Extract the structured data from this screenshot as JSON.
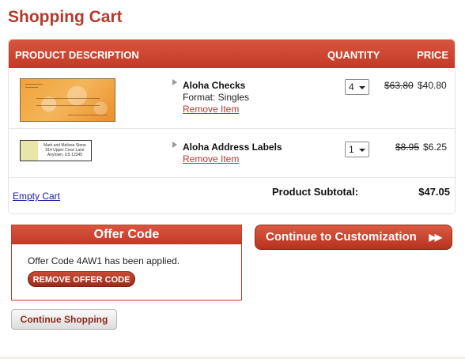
{
  "page": {
    "title": "Shopping Cart"
  },
  "cart": {
    "headers": {
      "description": "PRODUCT DESCRIPTION",
      "quantity": "QUANTITY",
      "price": "PRICE"
    },
    "items": [
      {
        "name": "Aloha Checks",
        "format": "Format: Singles",
        "remove_label": "Remove Item",
        "quantity": "4",
        "old_price": "$63.80",
        "new_price": "$40.80"
      },
      {
        "name": "Aloha Address Labels",
        "remove_label": "Remove Item",
        "quantity": "1",
        "old_price": "$8.95",
        "new_price": "$6.25",
        "label_preview": [
          "Mark and Melissa Stone",
          "914 Upper Crest Lane",
          "Anytown, US 12345"
        ]
      }
    ],
    "empty_cart_label": "Empty Cart",
    "subtotal_label": "Product Subtotal:",
    "subtotal_value": "$47.05"
  },
  "offer": {
    "title": "Offer Code",
    "message": "Offer Code 4AW1 has been applied.",
    "remove_button": "REMOVE OFFER CODE"
  },
  "actions": {
    "continue_customization": "Continue to Customization",
    "continue_customization_arrow": "▶▶",
    "continue_shopping": "Continue Shopping"
  },
  "colors": {
    "accent_red": "#c23a26",
    "title_red": "#b33a2c",
    "link_blue": "#1a1aa6"
  },
  "icons": {
    "item_arrow": "triangle-right-icon",
    "select_caret": "chevron-down-icon",
    "forward": "double-arrow-right-icon"
  }
}
